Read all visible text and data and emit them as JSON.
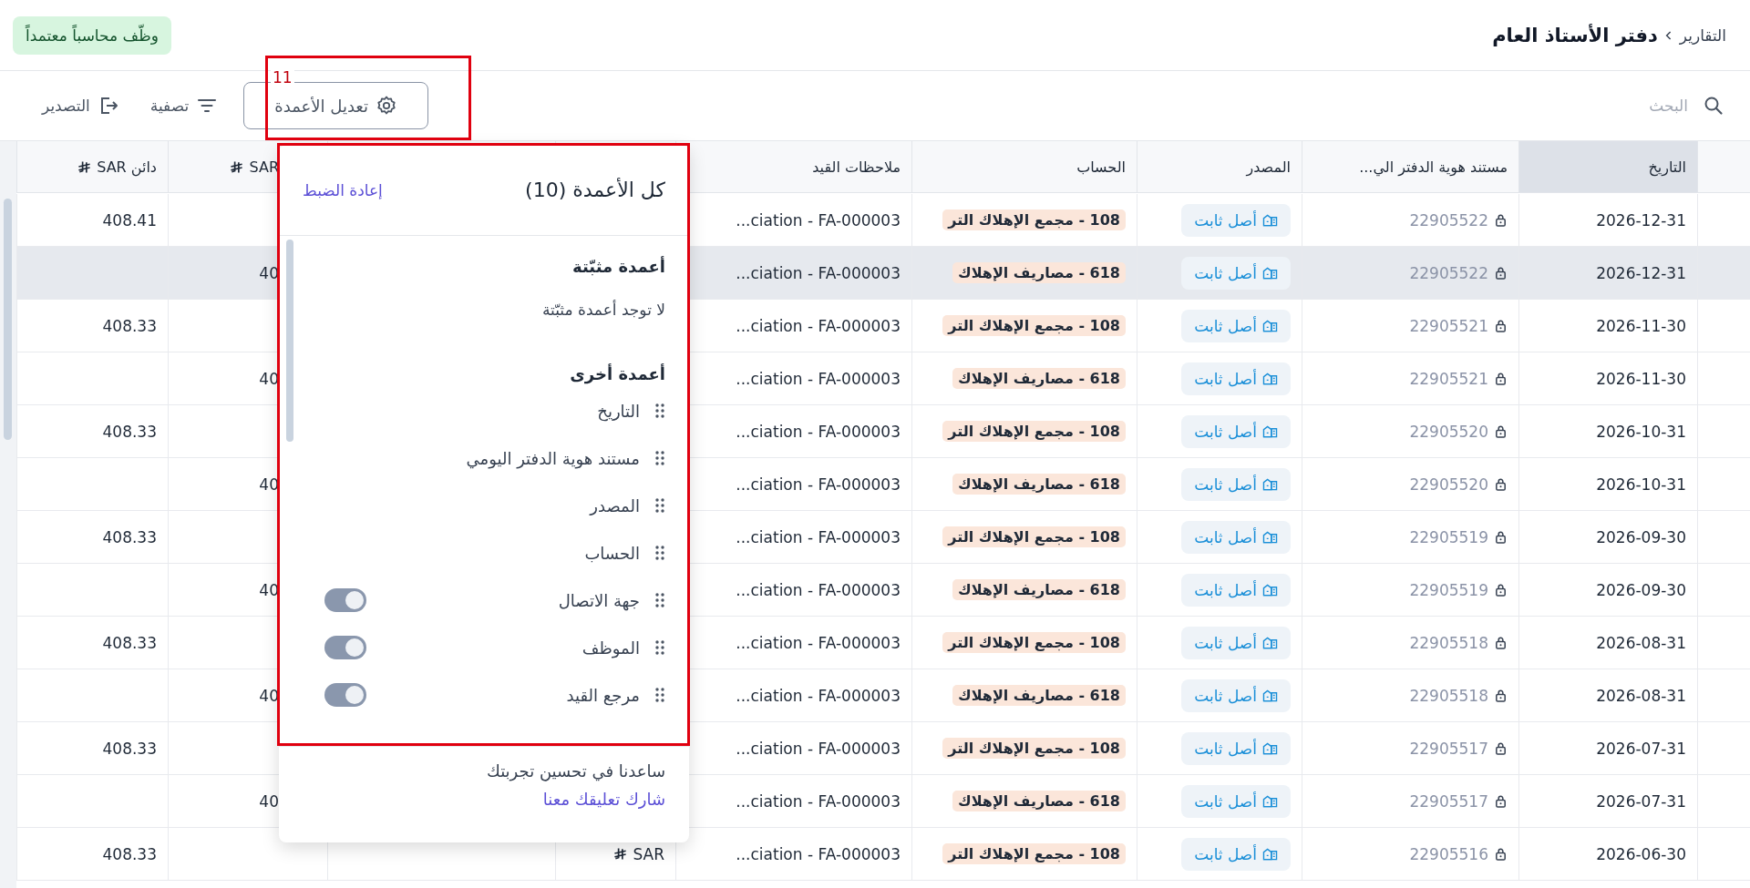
{
  "header": {
    "breadcrumb": [
      {
        "label": "التقارير"
      },
      {
        "label": "دفتر الأستاذ العام"
      }
    ],
    "promo_badge": "وظّف محاسباً معتمداً"
  },
  "toolbar": {
    "search": {
      "placeholder": "البحث"
    },
    "buttons": [
      {
        "kind": "columns",
        "label": "تعديل الأعمدة"
      },
      {
        "kind": "filter",
        "label": "تصفية"
      },
      {
        "kind": "export",
        "label": "التصدير"
      }
    ]
  },
  "annotation_label": "11",
  "table": {
    "columns": [
      {
        "label": "التاريخ",
        "highlighted": true,
        "currency": false
      },
      {
        "label": "مستند هوية الدفتر الي...",
        "highlighted": false,
        "currency": false
      },
      {
        "label": "المصدر",
        "highlighted": false,
        "currency": false
      },
      {
        "label": "الحساب",
        "highlighted": false,
        "currency": false
      },
      {
        "label": "ملاحظات القيد",
        "highlighted": false,
        "currency": false
      },
      {
        "highlighted": false
      },
      {
        "highlighted": false
      },
      {
        "label": "SAR",
        "highlighted": false,
        "currency": true
      },
      {
        "label": "دائن SAR",
        "highlighted": false,
        "currency": true
      }
    ],
    "rows": [
      {
        "date": "2026-12-31",
        "doc_id": "22905522",
        "source": "أصل ثابت",
        "account": "108 - مجمع الإهلاك التر",
        "note": "...ciation - FA-000003",
        "credit": "408.41",
        "hovered": false
      },
      {
        "date": "2026-12-31",
        "doc_id": "22905522",
        "source": "أصل ثابت",
        "account": "618 - مصاريف الإهلاك",
        "note": "...ciation - FA-000003",
        "debit": "40",
        "hovered": true
      },
      {
        "date": "2026-11-30",
        "doc_id": "22905521",
        "source": "أصل ثابت",
        "account": "108 - مجمع الإهلاك التر",
        "note": "...ciation - FA-000003",
        "credit": "408.33",
        "hovered": false
      },
      {
        "date": "2026-11-30",
        "doc_id": "22905521",
        "source": "أصل ثابت",
        "account": "618 - مصاريف الإهلاك",
        "note": "...ciation - FA-000003",
        "debit": "40",
        "hovered": false
      },
      {
        "date": "2026-10-31",
        "doc_id": "22905520",
        "source": "أصل ثابت",
        "account": "108 - مجمع الإهلاك التر",
        "note": "...ciation - FA-000003",
        "credit": "408.33",
        "hovered": false
      },
      {
        "date": "2026-10-31",
        "doc_id": "22905520",
        "source": "أصل ثابت",
        "account": "618 - مصاريف الإهلاك",
        "note": "...ciation - FA-000003",
        "debit": "40",
        "hovered": false
      },
      {
        "date": "2026-09-30",
        "doc_id": "22905519",
        "source": "أصل ثابت",
        "account": "108 - مجمع الإهلاك التر",
        "note": "...ciation - FA-000003",
        "credit": "408.33",
        "hovered": false
      },
      {
        "date": "2026-09-30",
        "doc_id": "22905519",
        "source": "أصل ثابت",
        "account": "618 - مصاريف الإهلاك",
        "note": "...ciation - FA-000003",
        "debit": "40",
        "hovered": false
      },
      {
        "date": "2026-08-31",
        "doc_id": "22905518",
        "source": "أصل ثابت",
        "account": "108 - مجمع الإهلاك التر",
        "note": "...ciation - FA-000003",
        "credit": "408.33",
        "hovered": false
      },
      {
        "date": "2026-08-31",
        "doc_id": "22905518",
        "source": "أصل ثابت",
        "account": "618 - مصاريف الإهلاك",
        "note": "...ciation - FA-000003",
        "debit": "40",
        "hovered": false
      },
      {
        "date": "2026-07-31",
        "doc_id": "22905517",
        "source": "أصل ثابت",
        "account": "108 - مجمع الإهلاك التر",
        "note": "...ciation - FA-000003",
        "credit": "408.33",
        "hovered": false
      },
      {
        "date": "2026-07-31",
        "doc_id": "22905517",
        "source": "أصل ثابت",
        "account": "618 - مصاريف الإهلاك",
        "note": "...ciation - FA-000003",
        "debit": "40",
        "hovered": false
      },
      {
        "date": "2026-06-30",
        "doc_id": "22905516",
        "source": "أصل ثابت",
        "account": "108 - مجمع الإهلاك التر",
        "note": "...ciation - FA-000003",
        "column_6": "SAR",
        "credit": "408.33",
        "hovered": false
      }
    ]
  },
  "column_menu": {
    "title": "كل الأعمدة (10)",
    "reset": "إعادة الضبط",
    "sections": [
      {
        "title": "أعمدة مثبّتة",
        "empty_text": "لا توجد أعمدة مثبّتة"
      },
      {
        "title": "أعمدة أخرى",
        "items": [
          {
            "label": "التاريخ",
            "kind": "fixed"
          },
          {
            "label": "مستند هوية الدفتر اليومي",
            "kind": "fixed"
          },
          {
            "label": "المصدر",
            "kind": "fixed"
          },
          {
            "label": "الحساب",
            "kind": "fixed"
          },
          {
            "label": "جهة الاتصال",
            "kind": "toggle",
            "on": true
          },
          {
            "label": "الموظف",
            "kind": "toggle",
            "on": true
          },
          {
            "label": "مرجع القيد",
            "kind": "toggle",
            "on": true
          }
        ]
      }
    ],
    "footer": {
      "text": "ساعدنا في تحسين تجربتك",
      "link": "شارك تعليقك معنا"
    }
  }
}
